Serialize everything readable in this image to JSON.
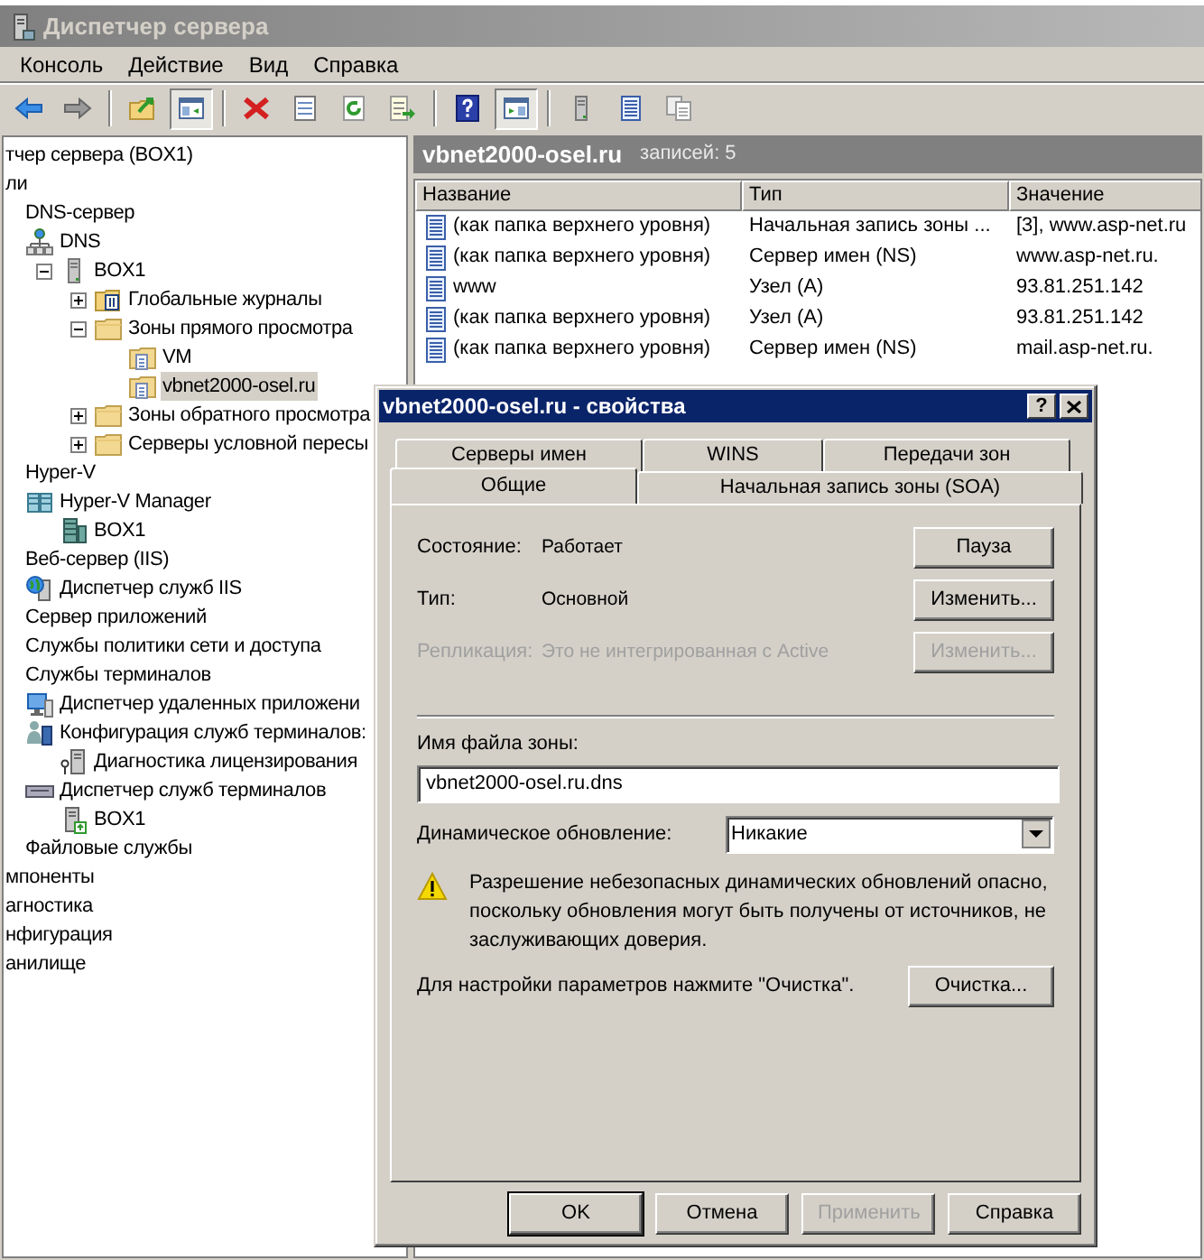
{
  "window": {
    "title": "Диспетчер сервера"
  },
  "menu": [
    "Консоль",
    "Действие",
    "Вид",
    "Справка"
  ],
  "toolbar": [
    {
      "kind": "back",
      "pressed": false
    },
    {
      "kind": "forward",
      "pressed": false
    },
    {
      "kind": "separator"
    },
    {
      "kind": "up",
      "pressed": false
    },
    {
      "kind": "console-tree",
      "pressed": true
    },
    {
      "kind": "separator"
    },
    {
      "kind": "delete",
      "pressed": false
    },
    {
      "kind": "properties",
      "pressed": false
    },
    {
      "kind": "refresh",
      "pressed": false
    },
    {
      "kind": "export",
      "pressed": false
    },
    {
      "kind": "separator"
    },
    {
      "kind": "help",
      "pressed": false
    },
    {
      "kind": "action-pane",
      "pressed": true
    },
    {
      "kind": "separator"
    },
    {
      "kind": "server",
      "pressed": false
    },
    {
      "kind": "list",
      "pressed": false
    },
    {
      "kind": "copy",
      "pressed": false
    }
  ],
  "tree": [
    {
      "label": "тчер сервера (BOX1)",
      "selected": false,
      "children": [
        {
          "label": "ли",
          "selected": false,
          "children": [
            {
              "label": "DNS-сервер",
              "selected": false,
              "children": [
                {
                  "label": "DNS",
                  "kind": "dns",
                  "selected": false,
                  "children": [
                    {
                      "label": "BOX1",
                      "kind": "server",
                      "expanded": true,
                      "selected": false,
                      "children": [
                        {
                          "label": "Глобальные журналы",
                          "kind": "journal",
                          "expanded": false,
                          "selected": false
                        },
                        {
                          "label": "Зоны прямого просмотра",
                          "kind": "folder",
                          "expanded": true,
                          "selected": false,
                          "children": [
                            {
                              "label": "VM",
                              "kind": "zone",
                              "selected": false
                            },
                            {
                              "label": "vbnet2000-osel.ru",
                              "kind": "zone",
                              "selected": true
                            }
                          ]
                        },
                        {
                          "label": "Зоны обратного просмотра",
                          "kind": "folder",
                          "expanded": false,
                          "selected": false
                        },
                        {
                          "label": "Серверы условной пересы",
                          "kind": "folder",
                          "expanded": false,
                          "selected": false
                        }
                      ]
                    }
                  ]
                }
              ]
            },
            {
              "label": "Hyper-V",
              "selected": false,
              "children": [
                {
                  "label": "Hyper-V Manager",
                  "kind": "hyperv",
                  "selected": false,
                  "children": [
                    {
                      "label": "BOX1",
                      "kind": "hyperv-server",
                      "selected": false
                    }
                  ]
                }
              ]
            },
            {
              "label": "Веб-сервер (IIS)",
              "selected": false,
              "children": [
                {
                  "label": "Диспетчер служб IIS",
                  "kind": "iis",
                  "selected": false
                }
              ]
            },
            {
              "label": "Сервер приложений",
              "selected": false
            },
            {
              "label": "Службы политики сети и доступа",
              "selected": false
            },
            {
              "label": "Службы терминалов",
              "selected": false,
              "children": [
                {
                  "label": "Диспетчер удаленных приложени",
                  "kind": "remote",
                  "selected": false
                },
                {
                  "label": "Конфигурация служб терминалов:",
                  "kind": "ts-config",
                  "selected": false,
                  "children": [
                    {
                      "label": "Диагностика лицензирования",
                      "kind": "license",
                      "selected": false
                    }
                  ]
                },
                {
                  "label": "Диспетчер служб терминалов",
                  "kind": "ts-manager",
                  "selected": false,
                  "children": [
                    {
                      "label": "BOX1",
                      "kind": "ts-server",
                      "selected": false
                    }
                  ]
                }
              ]
            },
            {
              "label": "Файловые службы",
              "selected": false
            }
          ]
        },
        {
          "label": "мпоненты",
          "selected": false
        },
        {
          "label": "агностика",
          "selected": false
        },
        {
          "label": "нфигурация",
          "selected": false
        },
        {
          "label": "анилище",
          "selected": false
        }
      ]
    }
  ],
  "details": {
    "title": "vbnet2000-osel.ru",
    "count": "записей: 5",
    "columns": [
      "Название",
      "Тип",
      "Значение"
    ],
    "rows": [
      {
        "name": "(как папка верхнего уровня)",
        "type": "Начальная запись зоны ...",
        "value": "[3], www.asp-net.ru"
      },
      {
        "name": "(как папка верхнего уровня)",
        "type": "Сервер имен (NS)",
        "value": "www.asp-net.ru."
      },
      {
        "name": "www",
        "type": "Узел (A)",
        "value": "93.81.251.142"
      },
      {
        "name": "(как папка верхнего уровня)",
        "type": "Узел (A)",
        "value": "93.81.251.142"
      },
      {
        "name": "(как папка верхнего уровня)",
        "type": "Сервер имен (NS)",
        "value": "mail.asp-net.ru."
      }
    ]
  },
  "dialog": {
    "title": "vbnet2000-osel.ru - свойства",
    "help_button": "?",
    "tab_rows": [
      {
        "tabs": [
          {
            "label": "Серверы имен",
            "selected": false
          },
          {
            "label": "WINS",
            "selected": false
          },
          {
            "label": "Передачи зон",
            "selected": false
          }
        ]
      },
      {
        "tabs": [
          {
            "label": "Общие",
            "selected": true
          },
          {
            "label": "Начальная запись зоны (SOA)",
            "selected": false
          }
        ]
      }
    ],
    "properties": [
      {
        "label": "Состояние:",
        "value": "Работает",
        "disabled": false,
        "button": {
          "label": "Пауза",
          "disabled": false
        }
      },
      {
        "label": "Тип:",
        "value": "Основной",
        "disabled": false,
        "button": {
          "label": "Изменить...",
          "disabled": false
        }
      },
      {
        "label": "Репликация:",
        "value": "Это не интегрированная с Active",
        "disabled": true,
        "button": {
          "label": "Изменить...",
          "disabled": true
        }
      }
    ],
    "zone_file": {
      "label": "Имя файла зоны:",
      "value": "vbnet2000-osel.ru.dns"
    },
    "dynamic_update": {
      "label": "Динамическое обновление:",
      "value": "Никакие"
    },
    "warning": "Разрешение небезопасных динамических обновлений опасно, поскольку обновления могут быть получены от источников, не заслуживающих доверия.",
    "scavenging": {
      "text": "Для настройки параметров нажмите \"Очистка\".",
      "button": "Очистка..."
    },
    "buttons": [
      {
        "label": "OK",
        "default": true,
        "disabled": false
      },
      {
        "label": "Отмена",
        "default": false,
        "disabled": false
      },
      {
        "label": "Применить",
        "default": false,
        "disabled": true
      },
      {
        "label": "Справка",
        "default": false,
        "disabled": false
      }
    ]
  }
}
